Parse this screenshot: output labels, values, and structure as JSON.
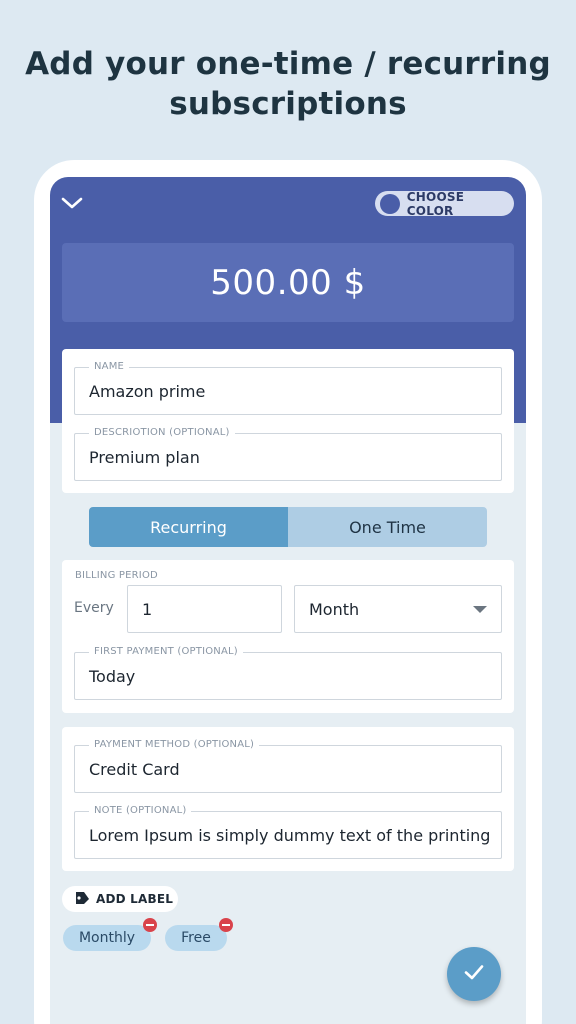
{
  "headline": {
    "line1": "Add your one-time / recurring",
    "line2": "subscriptions"
  },
  "header": {
    "choose_color_label": "CHOOSE COLOR",
    "amount": "500.00 $"
  },
  "details": {
    "name_label": "NAME",
    "name_value": "Amazon prime",
    "description_label": "DESCRIOTION (OPTIONAL)",
    "description_value": "Premium plan"
  },
  "type_toggle": {
    "recurring_label": "Recurring",
    "one_time_label": "One Time",
    "selected": "Recurring"
  },
  "billing": {
    "section_label": "BILLING PERIOD",
    "every_label": "Every",
    "interval_value": "1",
    "period_value": "Month",
    "first_payment_label": "FIRST PAYMENT (OPTIONAL)",
    "first_payment_value": "Today"
  },
  "extra": {
    "payment_method_label": "PAYMENT METHOD (OPTIONAL)",
    "payment_method_value": "Credit Card",
    "note_label": "NOTE (OPTIONAL)",
    "note_value": "Lorem Ipsum is simply dummy text of the printing"
  },
  "labels": {
    "add_label": "ADD LABEL",
    "chips": [
      "Monthly",
      "Free"
    ]
  },
  "icons": {
    "collapse": "chevron-down-icon",
    "tag": "tag-icon",
    "remove": "remove-icon",
    "confirm": "check-icon"
  },
  "colors": {
    "header": "#4a5ea8",
    "amount_box": "#5a6eb6",
    "accent": "#5b9dc8",
    "toggle_inactive": "#aecde4",
    "chip": "#b9d9ee",
    "remove": "#d9434b",
    "background": "#dde9f2"
  }
}
